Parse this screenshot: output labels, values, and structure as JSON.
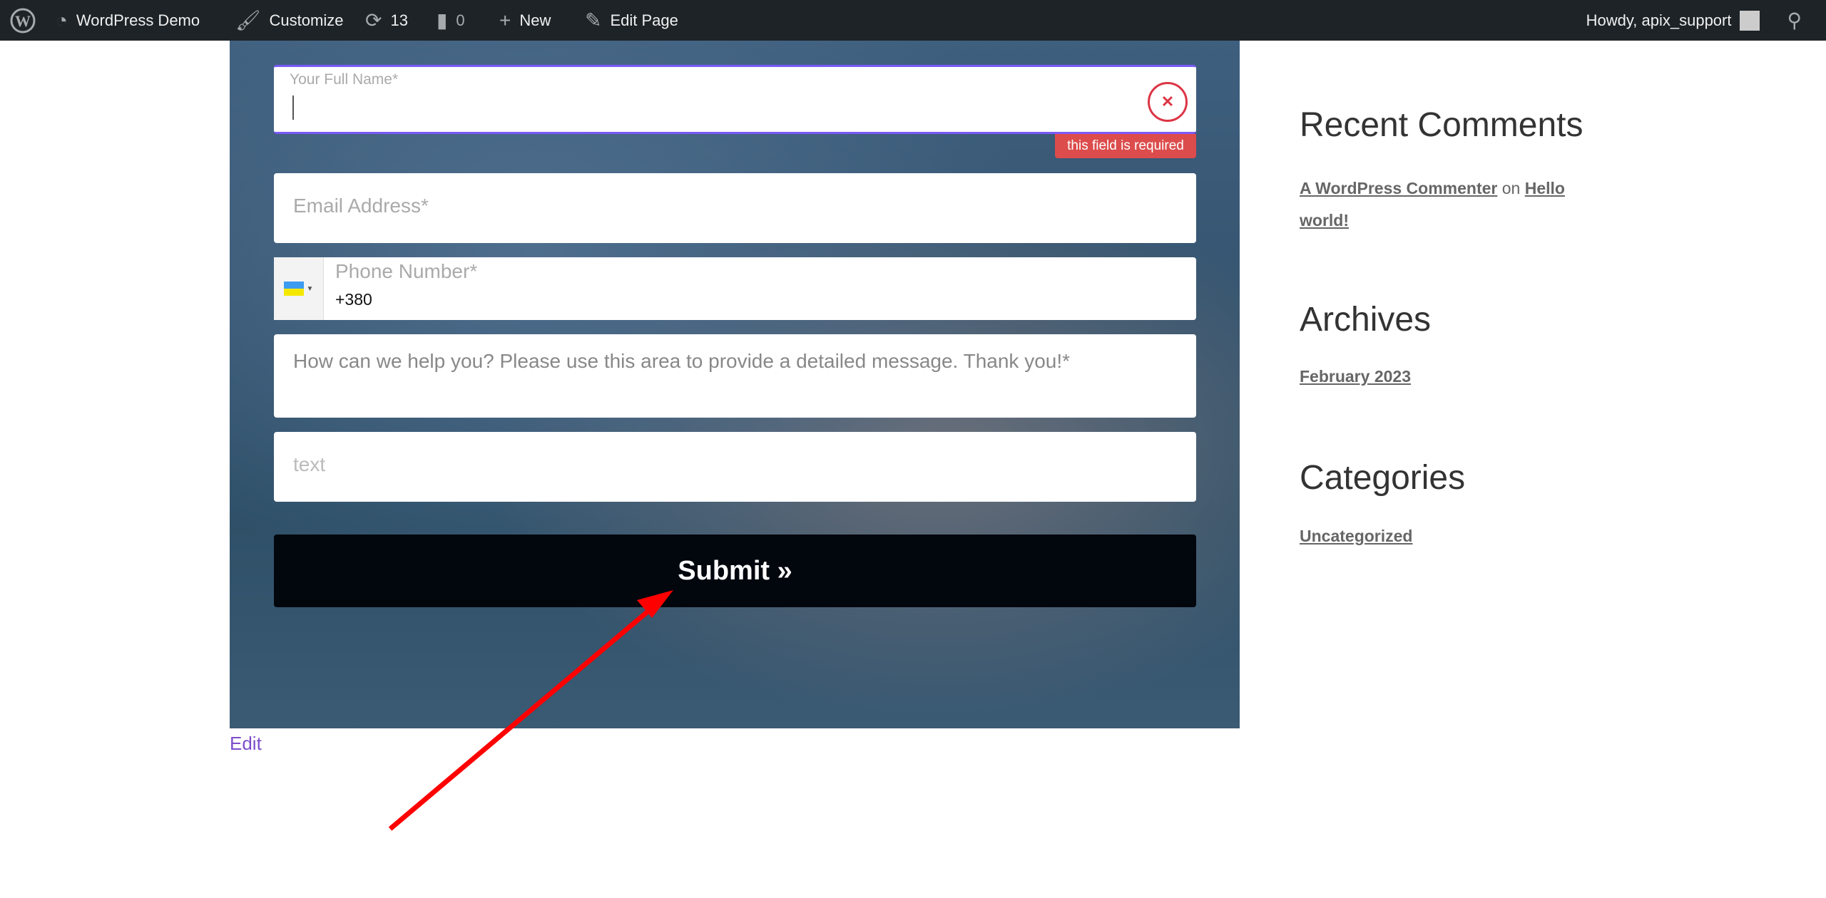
{
  "adminbar": {
    "site": "WordPress Demo",
    "customize": "Customize",
    "updates": "13",
    "comments": "0",
    "new": "New",
    "edit_page": "Edit Page",
    "howdy": "Howdy, apix_support"
  },
  "form": {
    "name_label": "Your Full Name*",
    "name_error": "this field is required",
    "email_placeholder": "Email Address*",
    "phone_label": "Phone Number*",
    "phone_value": "+380",
    "phone_country": "Ukraine",
    "message_placeholder": "How can we help you? Please use this area to provide a detailed message. Thank you!*",
    "text_placeholder": "text",
    "submit": "Submit »"
  },
  "edit_link": "Edit",
  "sidebar": {
    "recent_comments": {
      "title": "Recent Comments",
      "author": "A WordPress Commenter",
      "on": "on",
      "post_line1": "Hello",
      "post_line2": "world!"
    },
    "archives": {
      "title": "Archives",
      "items": [
        "February 2023"
      ]
    },
    "categories": {
      "title": "Categories",
      "items": [
        "Uncategorized"
      ]
    }
  },
  "colors": {
    "adminbar": "#1d2327",
    "error": "#dc3545",
    "submit": "#02060d",
    "annotation_arrow": "#ff0000"
  }
}
